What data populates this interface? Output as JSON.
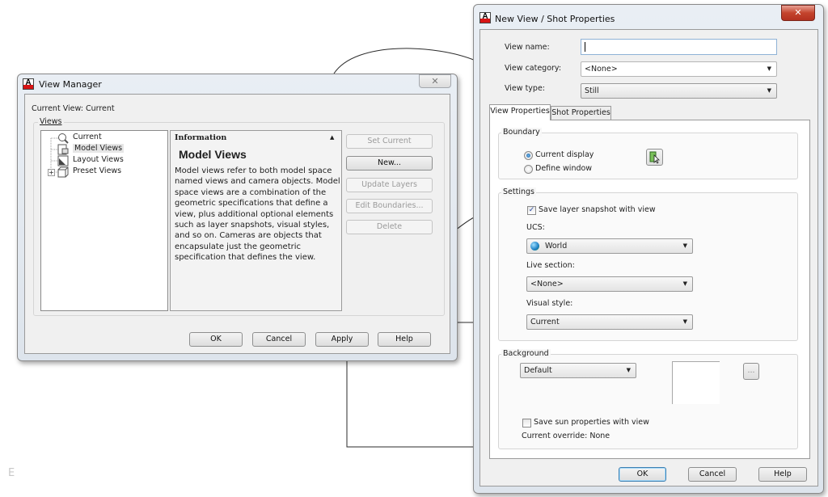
{
  "connectors": {
    "color": "#2b2b2b"
  },
  "watermark": {
    "glyph": "E"
  },
  "view_manager": {
    "title": "View Manager",
    "close_glyph": "✕",
    "current_view_label": "Current View: Current",
    "views_group_label": "Views",
    "tree": [
      {
        "label": "Current",
        "icon": "magnifier-icon",
        "glyph": "🔍",
        "expander": false
      },
      {
        "label": "Model Views",
        "icon": "model-views-icon",
        "glyph": "▣",
        "expander": false,
        "selected": true
      },
      {
        "label": "Layout Views",
        "icon": "layout-views-icon",
        "glyph": "◩",
        "expander": false
      },
      {
        "label": "Preset Views",
        "icon": "cube-icon",
        "glyph": "◫",
        "expander": true,
        "expander_glyph": "+"
      }
    ],
    "info": {
      "header": "Information",
      "collapse_glyph": "▲",
      "title": "Model Views",
      "body": "Model views refer to both model space named views and camera objects. Model space views are a combination of the geometric specifications that define a view, plus additional optional elements such as layer snapshots, visual styles, and so on. Cameras are objects that encapsulate just the geometric specification that defines the view."
    },
    "side_buttons": [
      {
        "label": "Set Current",
        "enabled": false
      },
      {
        "label": "New...",
        "enabled": true
      },
      {
        "label": "Update Layers",
        "enabled": false
      },
      {
        "label": "Edit Boundaries...",
        "enabled": false
      },
      {
        "label": "Delete",
        "enabled": false
      }
    ],
    "footer_buttons": {
      "ok": "OK",
      "cancel": "Cancel",
      "apply": "Apply",
      "help": "Help"
    }
  },
  "new_view": {
    "title": "New View / Shot Properties",
    "close_glyph": "✕",
    "view_name": {
      "label": "View name:",
      "value": ""
    },
    "view_category": {
      "label": "View category:",
      "value": "<None>"
    },
    "view_type": {
      "label": "View type:",
      "value": "Still"
    },
    "tabs": [
      {
        "label": "View Properties",
        "active": true
      },
      {
        "label": "Shot Properties",
        "active": false
      }
    ],
    "boundary": {
      "title": "Boundary",
      "options": [
        {
          "label": "Current display",
          "selected": true
        },
        {
          "label": "Define window",
          "selected": false
        }
      ],
      "pick_button_icon": "define-window-pick-icon"
    },
    "settings": {
      "title": "Settings",
      "save_layer_snapshot": {
        "label": "Save layer snapshot with view",
        "checked": true
      },
      "ucs": {
        "label": "UCS:",
        "value": "World"
      },
      "live_section": {
        "label": "Live section:",
        "value": "<None>"
      },
      "visual_style": {
        "label": "Visual style:",
        "value": "Current"
      }
    },
    "background": {
      "title": "Background",
      "value": "Default",
      "browse_label": "...",
      "save_sun": {
        "label": "Save sun properties with view",
        "checked": false
      },
      "current_override": "Current override: None"
    },
    "footer_buttons": {
      "ok": "OK",
      "cancel": "Cancel",
      "help": "Help"
    },
    "dropdown_glyph": "▼"
  }
}
